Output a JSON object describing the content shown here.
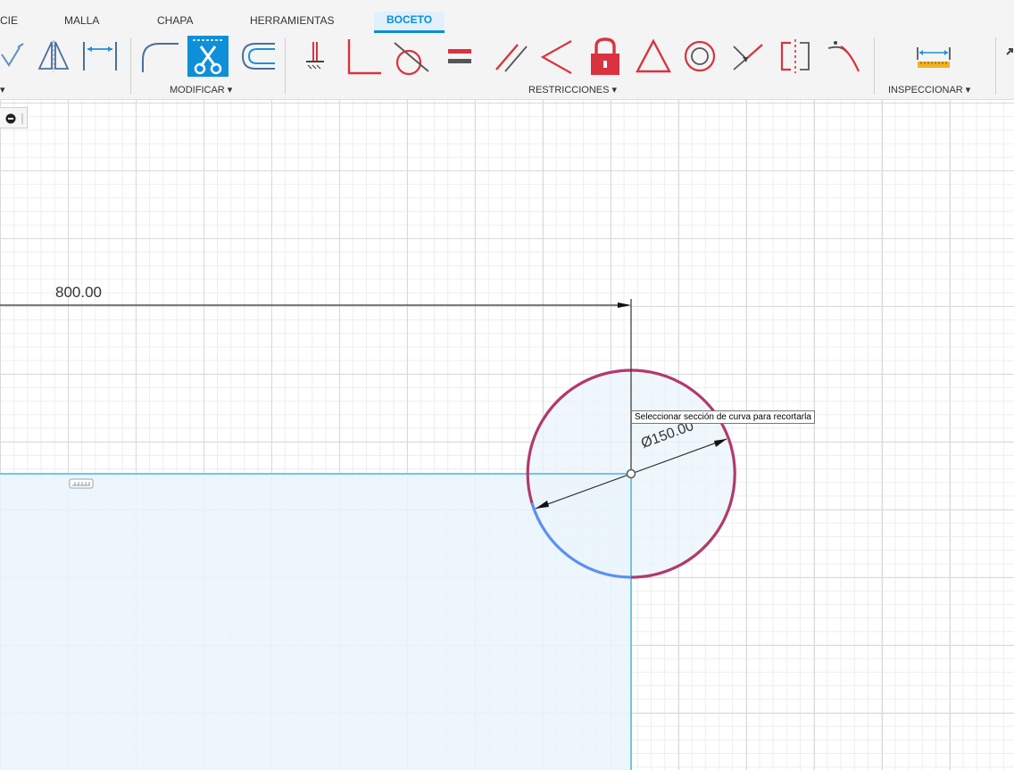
{
  "tabs": [
    {
      "label": "CIE",
      "active": false
    },
    {
      "label": "MALLA",
      "active": false
    },
    {
      "label": "CHAPA",
      "active": false
    },
    {
      "label": "HERRAMIENTAS",
      "active": false
    },
    {
      "label": "BOCETO",
      "active": true
    }
  ],
  "groups": {
    "modificar": "MODIFICAR ▾",
    "restricciones": "RESTRICCIONES ▾",
    "inspeccionar": "INSPECCIONAR ▾",
    "crear": "▾"
  },
  "tools": {
    "crear": [
      "line-icon",
      "mirror-icon",
      "dimension-icon"
    ],
    "modificar": [
      "fillet-icon",
      "trim-icon",
      "offset-icon"
    ],
    "restricciones": [
      "fix-icon",
      "perpendicular-icon",
      "tangent-icon",
      "equal-icon",
      "parallel-icon",
      "coincident-icon",
      "lock-icon",
      "triangle-icon",
      "concentric-icon",
      "midpoint-icon",
      "symmetry-icon",
      "curvature-icon"
    ],
    "inspeccionar": [
      "measure-icon"
    ]
  },
  "active_tool": "trim-icon",
  "canvas": {
    "dimension_horizontal": "800.00",
    "dimension_diameter": "Ø150.00",
    "tooltip": "Seleccionar sección de curva para recortarla"
  },
  "colors": {
    "accent": "#0a8fd8",
    "circle_red": "#b23a6b",
    "circle_blue": "#5b8ff5",
    "profile_fill": "#eaf4fb",
    "profile_line": "#6fc5e8",
    "restriction_red": "#d9333f"
  }
}
